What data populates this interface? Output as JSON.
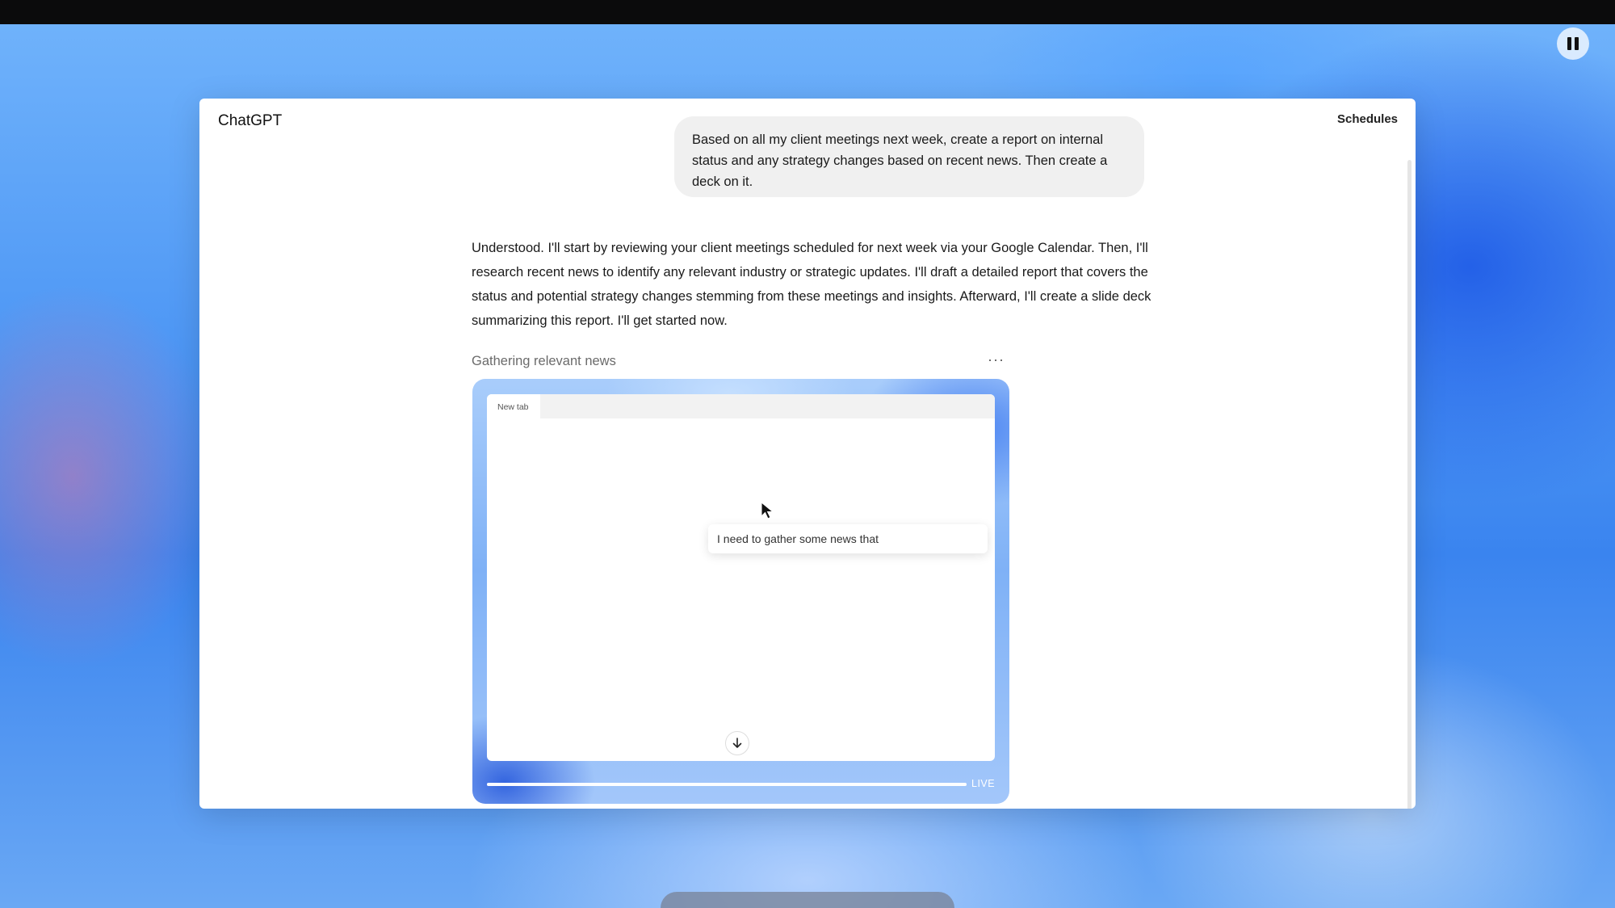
{
  "app": {
    "title": "ChatGPT",
    "schedules_label": "Schedules"
  },
  "conversation": {
    "user_message": "Based on all my client meetings next week, create a report on internal status and any strategy changes based on recent news. Then create a deck on it.",
    "assistant_message": "Understood. I'll start by reviewing your client meetings scheduled for next week via your Google Calendar. Then, I'll research recent news to identify any relevant industry or strategic updates. I'll draft a detailed report that covers the status and potential strategy changes stemming from these meetings and insights. Afterward, I'll create a slide deck summarizing this report. I'll get started now."
  },
  "agent_status": {
    "label": "Gathering relevant news",
    "more_icon": "ellipsis-icon"
  },
  "browser_preview": {
    "tab_label": "New tab",
    "typed_text": "I need to gather some news that",
    "live_label": "LIVE",
    "progress": 1.0,
    "scroll_icon": "arrow-down-icon",
    "cursor_icon": "mouse-pointer-icon"
  },
  "controls": {
    "pause_icon": "pause-icon"
  }
}
